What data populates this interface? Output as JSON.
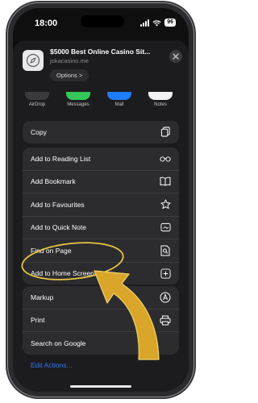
{
  "status": {
    "time": "18:00",
    "battery": "96"
  },
  "header": {
    "title": "$5000 Best Online Casino Sit...",
    "url": "jokacasino.me",
    "options_label": "Options",
    "options_chevron": ">"
  },
  "apps": [
    {
      "name": "AirDrop",
      "color": "#3a3a3c"
    },
    {
      "name": "Messages",
      "color": "#34c759"
    },
    {
      "name": "Mail",
      "color": "#1e7cf5"
    },
    {
      "name": "Notes",
      "color": "#f2f2f2"
    }
  ],
  "groups": [
    {
      "items": [
        {
          "label": "Copy",
          "icon": "copy-icon"
        }
      ]
    },
    {
      "items": [
        {
          "label": "Add to Reading List",
          "icon": "glasses-icon"
        },
        {
          "label": "Add Bookmark",
          "icon": "book-icon"
        },
        {
          "label": "Add to Favourites",
          "icon": "star-icon"
        },
        {
          "label": "Add to Quick Note",
          "icon": "quick-note-icon"
        },
        {
          "label": "Find on Page",
          "icon": "find-document-icon"
        },
        {
          "label": "Add to Home Screen",
          "icon": "add-square-icon"
        }
      ]
    },
    {
      "items": [
        {
          "label": "Markup",
          "icon": "markup-icon"
        },
        {
          "label": "Print",
          "icon": "printer-icon"
        },
        {
          "label": "Search on Google",
          "icon": ""
        }
      ]
    }
  ],
  "edit_actions": "Edit Actions...",
  "colors": {
    "accent": "#2f7cf6",
    "highlight": "#e8c547",
    "arrow": "#d9a62a"
  }
}
